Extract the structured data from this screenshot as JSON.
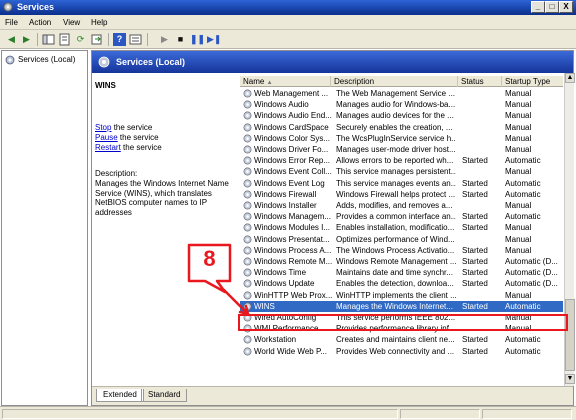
{
  "window": {
    "title": "Services",
    "min_label": "_",
    "max_label": "□",
    "close_label": "X"
  },
  "menu": {
    "items": [
      "File",
      "Action",
      "View",
      "Help"
    ]
  },
  "toolbar": {
    "icons": [
      "back-icon",
      "forward-icon",
      "console-tree-icon",
      "properties-icon",
      "refresh-icon",
      "export-icon",
      "help-icon",
      "view-icon",
      "start-icon",
      "stop-icon",
      "pause-icon",
      "restart-icon"
    ]
  },
  "tree": {
    "item": "Services (Local)"
  },
  "panel": {
    "title": "Services (Local)"
  },
  "details": {
    "service_name": "WINS",
    "actions": [
      {
        "link": "Stop",
        "rest": " the service"
      },
      {
        "link": "Pause",
        "rest": " the service"
      },
      {
        "link": "Restart",
        "rest": " the service"
      }
    ],
    "description_label": "Description:",
    "description": "Manages the Windows Internet Name Service (WINS), which translates NetBIOS computer names to IP addresses"
  },
  "columns": {
    "name": "Name",
    "sort_indicator": "▲",
    "description": "Description",
    "status": "Status",
    "startup": "Startup Type"
  },
  "services": [
    {
      "name": "Web Management ...",
      "desc": "The Web Management Service ...",
      "status": "",
      "startup": "Manual"
    },
    {
      "name": "Windows Audio",
      "desc": "Manages audio for Windows-ba...",
      "status": "",
      "startup": "Manual"
    },
    {
      "name": "Windows Audio End...",
      "desc": "Manages audio devices for the ...",
      "status": "",
      "startup": "Manual"
    },
    {
      "name": "Windows CardSpace",
      "desc": "Securely enables the creation, ...",
      "status": "",
      "startup": "Manual"
    },
    {
      "name": "Windows Color Sys...",
      "desc": "The WcsPlugInService service h...",
      "status": "",
      "startup": "Manual"
    },
    {
      "name": "Windows Driver Fo...",
      "desc": "Manages user-mode driver host...",
      "status": "",
      "startup": "Manual"
    },
    {
      "name": "Windows Error Rep...",
      "desc": "Allows errors to be reported wh...",
      "status": "Started",
      "startup": "Automatic"
    },
    {
      "name": "Windows Event Coll...",
      "desc": "This service manages persistent...",
      "status": "",
      "startup": "Manual"
    },
    {
      "name": "Windows Event Log",
      "desc": "This service manages events an...",
      "status": "Started",
      "startup": "Automatic"
    },
    {
      "name": "Windows Firewall",
      "desc": "Windows Firewall helps protect ...",
      "status": "Started",
      "startup": "Automatic"
    },
    {
      "name": "Windows Installer",
      "desc": "Adds, modifies, and removes a...",
      "status": "",
      "startup": "Manual"
    },
    {
      "name": "Windows Managem...",
      "desc": "Provides a common interface an...",
      "status": "Started",
      "startup": "Automatic"
    },
    {
      "name": "Windows Modules I...",
      "desc": "Enables installation, modificatio...",
      "status": "Started",
      "startup": "Manual"
    },
    {
      "name": "Windows Presentat...",
      "desc": "Optimizes performance of Wind...",
      "status": "",
      "startup": "Manual"
    },
    {
      "name": "Windows Process A...",
      "desc": "The Windows Process Activatio...",
      "status": "Started",
      "startup": "Manual"
    },
    {
      "name": "Windows Remote M...",
      "desc": "Windows Remote Management ...",
      "status": "Started",
      "startup": "Automatic (D..."
    },
    {
      "name": "Windows Time",
      "desc": "Maintains date and time synchr...",
      "status": "Started",
      "startup": "Automatic (D..."
    },
    {
      "name": "Windows Update",
      "desc": "Enables the detection, downloa...",
      "status": "Started",
      "startup": "Automatic (D..."
    },
    {
      "name": "WinHTTP Web Prox...",
      "desc": "WinHTTP implements the client ...",
      "status": "",
      "startup": "Manual"
    },
    {
      "name": "WINS",
      "desc": "Manages the Windows Internet...",
      "status": "Started",
      "startup": "Automatic",
      "selected": true
    },
    {
      "name": "Wired AutoConfig",
      "desc": "This service performs IEEE 802...",
      "status": "",
      "startup": "Manual"
    },
    {
      "name": "WMI Performance ...",
      "desc": "Provides performance library inf...",
      "status": "",
      "startup": "Manual"
    },
    {
      "name": "Workstation",
      "desc": "Creates and maintains client ne...",
      "status": "Started",
      "startup": "Automatic"
    },
    {
      "name": "World Wide Web P...",
      "desc": "Provides Web connectivity and ...",
      "status": "Started",
      "startup": "Automatic"
    }
  ],
  "tabs": [
    "Extended",
    "Standard"
  ],
  "callout": {
    "number": "8"
  },
  "colors": {
    "selection": "#316ac5",
    "highlight": "#e8181e",
    "title": "#0a2e8c"
  }
}
